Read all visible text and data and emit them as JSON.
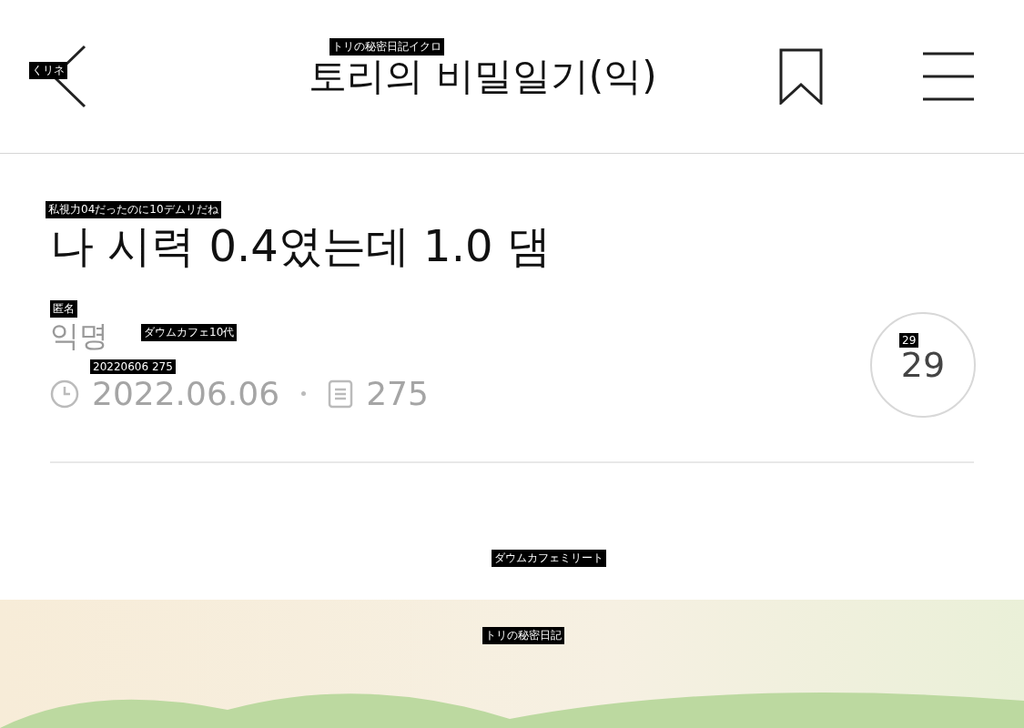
{
  "header": {
    "title": "토리의 비밀일기(익)"
  },
  "post": {
    "title": "나 시력 0.4였는데 1.0 댐",
    "author": "익명",
    "date": "2022.06.06",
    "views": "275",
    "comments": "29"
  },
  "overlay_labels": [
    {
      "text": "くリネ"
    },
    {
      "text": "トリの秘密日記イクロ"
    },
    {
      "text": "私視力04だったのに10デムリだね"
    },
    {
      "text": "匿名"
    },
    {
      "text": "ダウムカフェ10代"
    },
    {
      "text": "29"
    },
    {
      "text": "20220606 275"
    },
    {
      "text": "ダウムカフェミリート"
    },
    {
      "text": "トリの秘密日記"
    }
  ]
}
